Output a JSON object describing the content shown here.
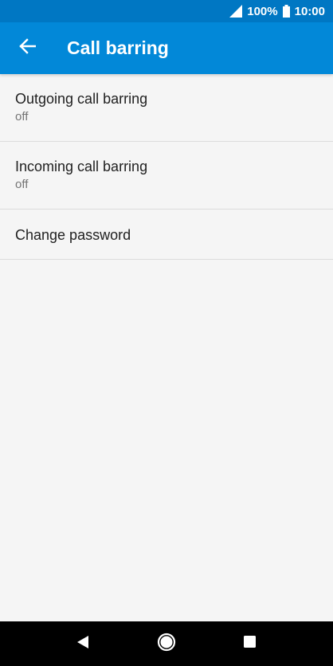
{
  "status_bar": {
    "battery_text": "100%",
    "time": "10:00",
    "background_color": "#0077c3",
    "signal_icon": "cell-signal-icon",
    "battery_icon": "battery-full-icon"
  },
  "app_bar": {
    "title": "Call barring",
    "back_icon": "arrow-left-icon",
    "background_color": "#0288d8"
  },
  "settings": {
    "items": [
      {
        "title": "Outgoing call barring",
        "summary": "off"
      },
      {
        "title": "Incoming call barring",
        "summary": "off"
      },
      {
        "title": "Change password"
      }
    ]
  },
  "nav_bar": {
    "back_icon": "triangle-back-icon",
    "home_icon": "circle-home-icon",
    "recents_icon": "square-recents-icon"
  }
}
